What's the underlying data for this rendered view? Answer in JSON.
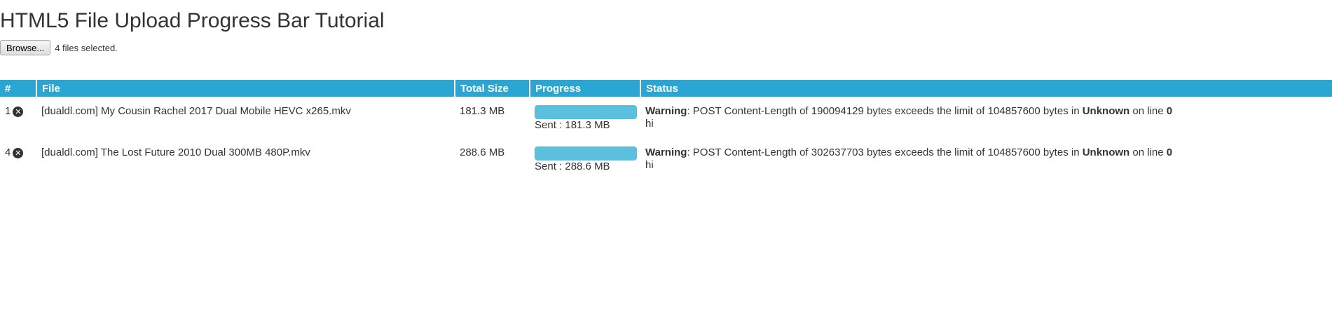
{
  "header": {
    "title": "HTML5 File Upload Progress Bar Tutorial"
  },
  "file_input": {
    "browse_label": "Browse...",
    "selection_text": "4 files selected."
  },
  "table": {
    "columns": [
      "#",
      "File",
      "Total Size",
      "Progress",
      "Status"
    ],
    "rows": [
      {
        "index": "1",
        "file": "[dualdl.com] My Cousin Rachel 2017 Dual Mobile HEVC x265.mkv",
        "size": "181.3 MB",
        "progress_fraction": 1.0,
        "sent": "Sent : 181.3 MB",
        "warning_label": "Warning",
        "warning_text": ": POST Content-Length of 190094129 bytes exceeds the limit of 104857600 bytes in ",
        "unknown_label": "Unknown",
        "line_text": " on line ",
        "line_number": "0",
        "extra": "hi"
      },
      {
        "index": "4",
        "file": "[dualdl.com] The Lost Future 2010 Dual 300MB 480P.mkv",
        "size": "288.6 MB",
        "progress_fraction": 1.0,
        "sent": "Sent : 288.6 MB",
        "warning_label": "Warning",
        "warning_text": ": POST Content-Length of 302637703 bytes exceeds the limit of 104857600 bytes in ",
        "unknown_label": "Unknown",
        "line_text": " on line ",
        "line_number": "0",
        "extra": "hi"
      }
    ]
  },
  "icons": {
    "remove": "remove-circle-icon"
  },
  "colors": {
    "header_bg": "#2ba6d3",
    "progress_fill": "#5bc0de",
    "text": "#333333"
  }
}
